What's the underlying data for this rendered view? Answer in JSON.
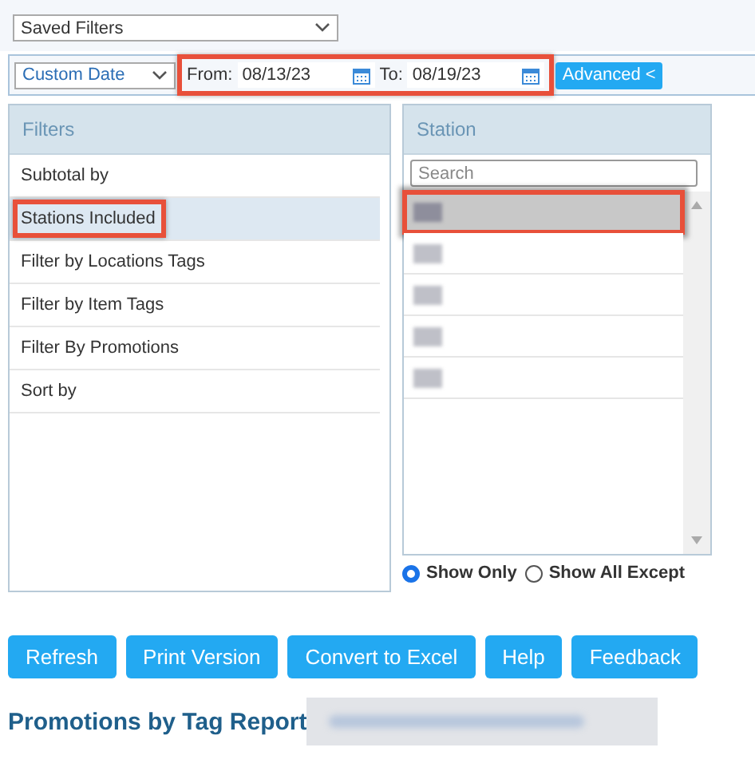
{
  "saved_filters": {
    "value": "Saved Filters"
  },
  "date_bar": {
    "range_select": "Custom Date",
    "from_label": "From:",
    "from_value": "08/13/23",
    "to_label": "To:",
    "to_value": "08/19/23",
    "highlighted": true,
    "advanced_button": "Advanced <"
  },
  "filters": {
    "heading": "Filters",
    "items": [
      {
        "label": "Subtotal by",
        "selected": false,
        "highlighted": false
      },
      {
        "label": "Stations Included",
        "selected": true,
        "highlighted": true
      },
      {
        "label": "Filter by Locations Tags",
        "selected": false,
        "highlighted": false
      },
      {
        "label": "Filter by Item Tags",
        "selected": false,
        "highlighted": false
      },
      {
        "label": "Filter By Promotions",
        "selected": false,
        "highlighted": false
      },
      {
        "label": "Sort by",
        "selected": false,
        "highlighted": false
      }
    ]
  },
  "station": {
    "heading": "Station",
    "search_placeholder": "Search",
    "items": [
      {
        "selected": true,
        "highlighted": true
      },
      {
        "selected": false,
        "highlighted": false
      },
      {
        "selected": false,
        "highlighted": false
      },
      {
        "selected": false,
        "highlighted": false
      },
      {
        "selected": false,
        "highlighted": false
      }
    ],
    "modes": [
      {
        "label": "Show Only",
        "selected": true
      },
      {
        "label": "Show All Except",
        "selected": false
      }
    ]
  },
  "buttons": [
    "Refresh",
    "Print Version",
    "Convert to Excel",
    "Help",
    "Feedback"
  ],
  "report_title": "Promotions by Tag Report"
}
